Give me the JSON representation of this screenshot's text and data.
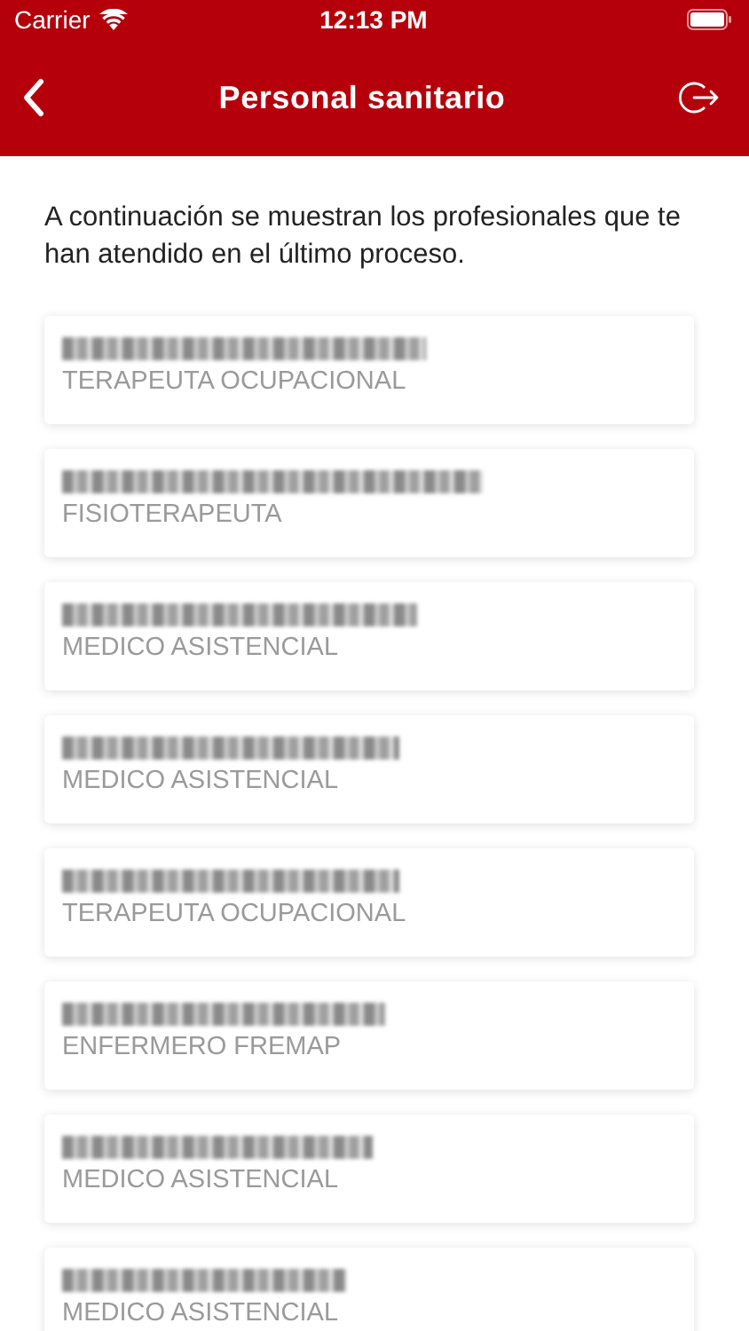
{
  "status_bar": {
    "carrier": "Carrier",
    "time": "12:13 PM"
  },
  "header": {
    "title": "Personal sanitario"
  },
  "intro": "A continuación se muestran los profesionales que te han atendido en el último proceso.",
  "professionals": [
    {
      "role": "TERAPEUTA OCUPACIONAL"
    },
    {
      "role": "FISIOTERAPEUTA"
    },
    {
      "role": "MEDICO ASISTENCIAL"
    },
    {
      "role": "MEDICO ASISTENCIAL"
    },
    {
      "role": "TERAPEUTA OCUPACIONAL"
    },
    {
      "role": "ENFERMERO FREMAP"
    },
    {
      "role": "MEDICO ASISTENCIAL"
    },
    {
      "role": "MEDICO ASISTENCIAL"
    }
  ]
}
